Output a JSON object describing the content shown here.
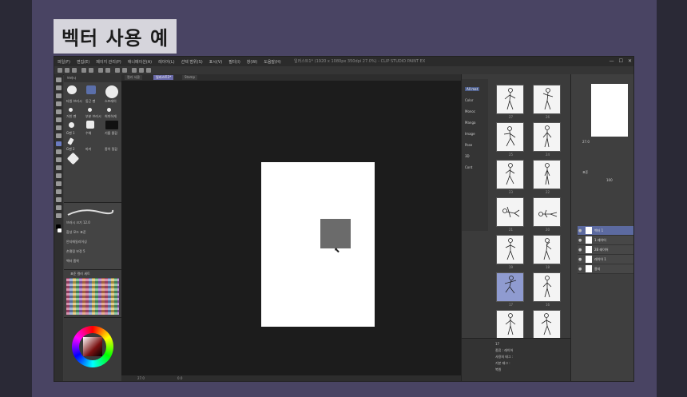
{
  "slide": {
    "title": "벡터 사용 예"
  },
  "app": {
    "window_title": "일러스트1* (1920 x 1080px 350dpi 27.0%) - CLIP STUDIO PAINT EX",
    "menu": [
      "파일(F)",
      "편집(E)",
      "페이지 관리(P)",
      "애니메이션(A)",
      "레이어(L)",
      "선택 범위(S)",
      "표시(V)",
      "필터(I)",
      "창(W)",
      "도움말(H)"
    ],
    "window_buttons": [
      "—",
      "☐",
      "✕"
    ],
    "tabs": [
      "컬러 서클",
      "일러스트1*",
      "Stamp"
    ],
    "status": {
      "zoom": "27.0",
      "angle": "0.0"
    }
  },
  "subtool": {
    "header": "브러시",
    "brushes": [
      "타원 브러시",
      "동근 펜",
      "스프레이",
      "거친 펜",
      "부분 브러시",
      "희미하게",
      "G펜 1",
      "수채",
      "기름 물감",
      "G펜 2",
      "마커",
      "종이 질감"
    ]
  },
  "tool_property": {
    "rows": [
      "브러시 크기 12.0",
      "합성 모드 표준",
      "안티에일리어싱",
      "손떨림 보정 5",
      "벡터 흡착"
    ]
  },
  "color_set": {
    "header": "표준 컬러 세트"
  },
  "material": {
    "tree": [
      "All mat",
      "Color",
      "Monoc",
      "Manga",
      "Image",
      "Pose",
      "3D",
      "Cont"
    ],
    "selected_tree_index": 0,
    "thumb_numbers": [
      "27",
      "26",
      "25",
      "24",
      "23",
      "22",
      "21",
      "20",
      "19",
      "18",
      "17",
      "16",
      "15",
      "14"
    ],
    "selected_thumb_index": 10,
    "info": [
      "17",
      "종류 : 레이어",
      "사용처 태그 :",
      "기본 태그 :",
      "복원"
    ]
  },
  "navigator": {
    "zoom": "27.0"
  },
  "layer_panel": {
    "blend": "표준",
    "opacity": "100",
    "layers": [
      {
        "name": "벡터 1",
        "selected": true
      },
      {
        "name": "1 레이어",
        "selected": false
      },
      {
        "name": "2B 레이어",
        "selected": false
      },
      {
        "name": "레이어 1",
        "selected": false
      },
      {
        "name": "용지",
        "selected": false
      }
    ]
  }
}
